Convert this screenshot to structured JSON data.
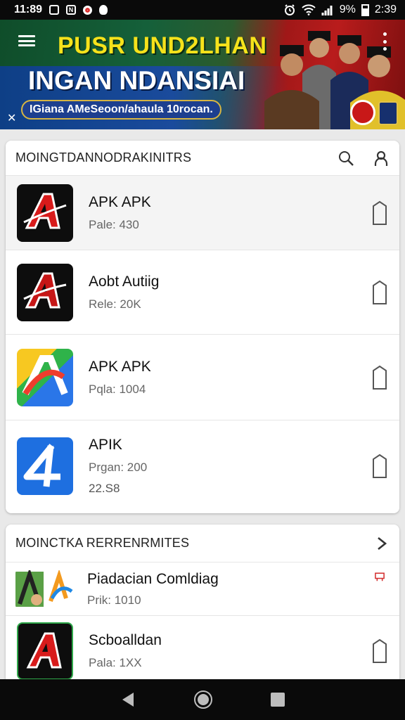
{
  "status_bar": {
    "time_left": "11:89",
    "battery": "9%",
    "time_right": "2:39",
    "icons": [
      "notification-n-icon",
      "notification-box-icon",
      "notification-dot-icon",
      "alarm-icon",
      "wifi-icon",
      "signal-icon",
      "battery-icon"
    ]
  },
  "banner": {
    "title": "PUSR UND2LHAN",
    "subtitle": "INGAN NDANSIAI",
    "ribbon": "IGiana AMeSeoon/ahaula 10rocan.",
    "accent_yellow": "#f6e21b",
    "accent_green": "#15603a",
    "accent_red": "#b91c1c"
  },
  "section1": {
    "header": "MOINGTDANNODRAKINITRS",
    "items": [
      {
        "title": "APK APK",
        "meta": "Pale: 430",
        "icon": "red-a-app-icon"
      },
      {
        "title": "Aobt Autiig",
        "meta": "Rele: 20K",
        "icon": "red-a-app-icon"
      },
      {
        "title": "APK APK",
        "meta": "Pqla: 1004",
        "icon": "colorful-a-app-icon"
      },
      {
        "title": "APIK",
        "meta": "Prgan: 200",
        "size": "22.S8",
        "icon": "blue-four-app-icon"
      }
    ]
  },
  "section2": {
    "header": "MOINCTKA RERRENRMITES",
    "items": [
      {
        "title": "Piadacian Comldiag",
        "meta": "Prik: 1010",
        "icon": "game-app-icon"
      },
      {
        "title": "Scboalldan",
        "meta": "Pala: 1XX",
        "icon": "red-a-app-icon"
      }
    ]
  }
}
